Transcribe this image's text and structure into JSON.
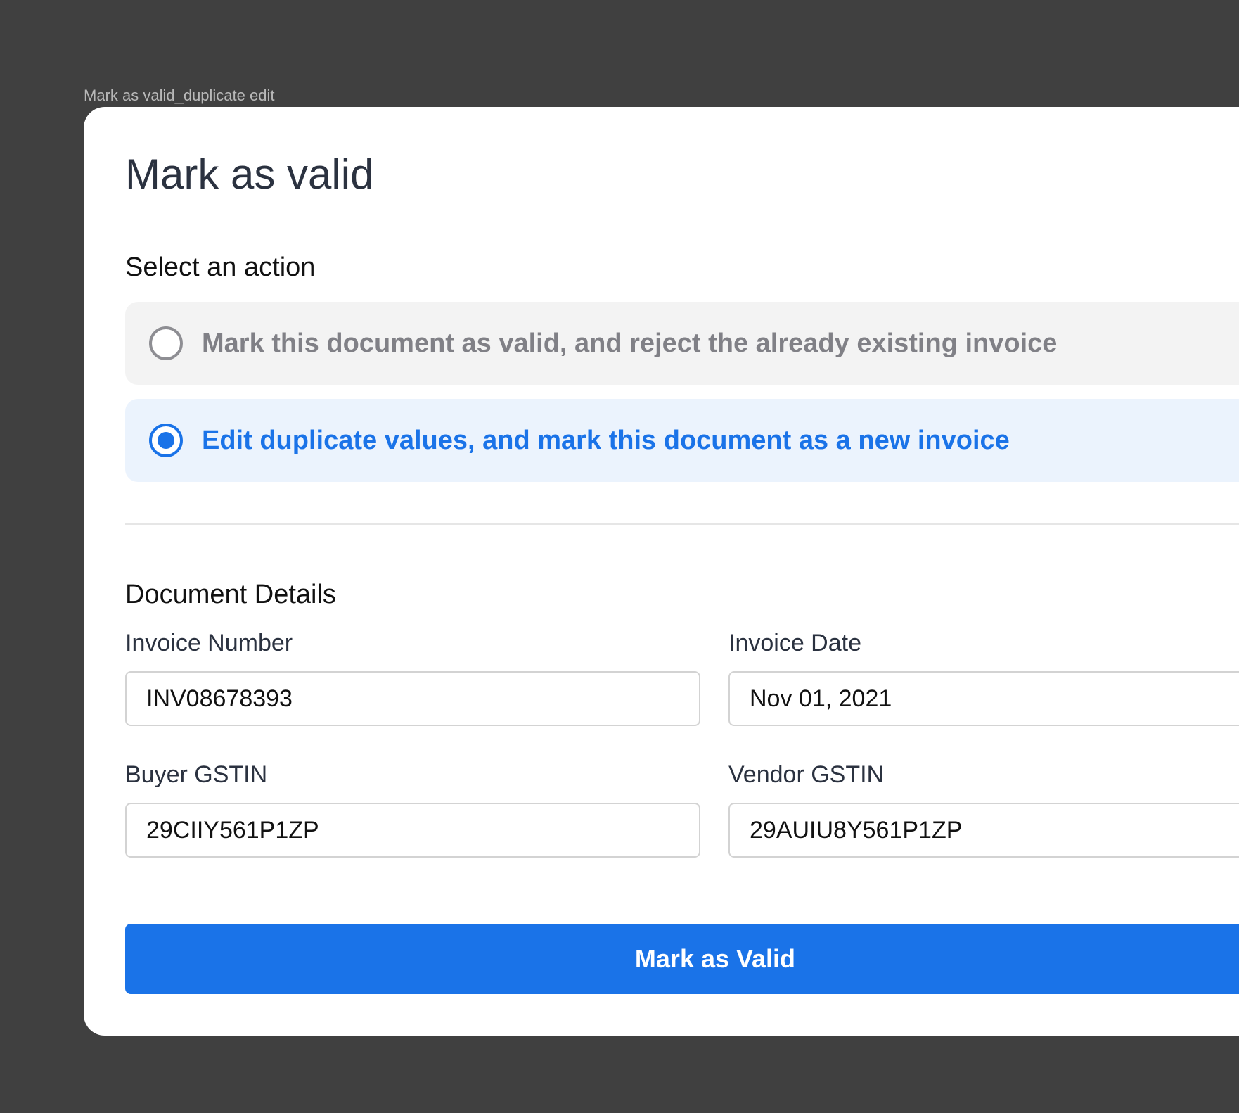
{
  "frame_label": "Mark as valid_duplicate edit",
  "dialog": {
    "title": "Mark as valid",
    "action_section": {
      "title": "Select an action",
      "options": [
        {
          "label": "Mark this document as valid, and reject the already existing invoice",
          "selected": false
        },
        {
          "label": "Edit duplicate values, and mark this document as a new invoice",
          "selected": true
        }
      ]
    },
    "details_section": {
      "title": "Document Details",
      "fields": {
        "invoice_number": {
          "label": "Invoice Number",
          "value": "INV08678393"
        },
        "invoice_date": {
          "label": "Invoice Date",
          "value": "Nov 01, 2021"
        },
        "buyer_gstin": {
          "label": "Buyer GSTIN",
          "value": "29CIIY561P1ZP"
        },
        "vendor_gstin": {
          "label": "Vendor GSTIN",
          "value": "29AUIU8Y561P1ZP"
        }
      }
    },
    "primary_button": {
      "label": "Mark as Valid"
    }
  },
  "colors": {
    "backdrop": "#404040",
    "accent": "#1a73e8",
    "selected_option_bg": "#ebf3fd",
    "unselected_option_bg": "#f3f3f3"
  },
  "icons": {
    "radio_unselected": "radio-unchecked-icon",
    "radio_selected": "radio-checked-icon"
  }
}
